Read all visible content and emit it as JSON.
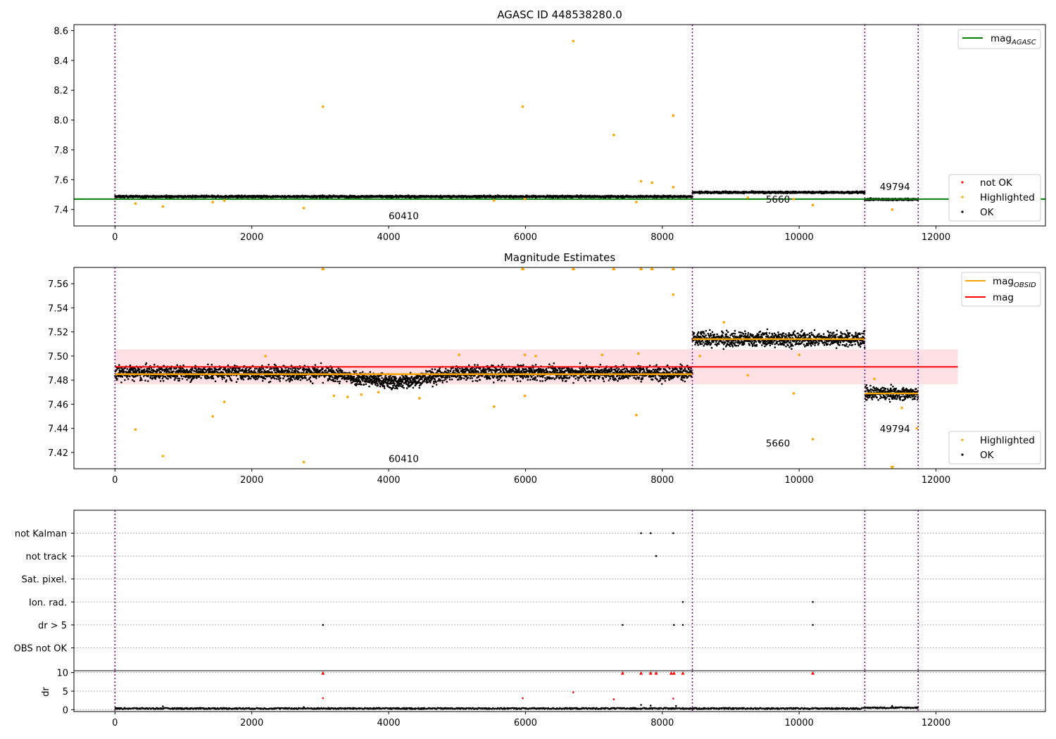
{
  "chart_data": [
    {
      "type": "scatter",
      "title": "AGASC ID 448538280.0",
      "xlabel": "",
      "ylabel": "",
      "xlim": [
        -600,
        13600
      ],
      "ylim": [
        7.29,
        8.64
      ],
      "xticks": [
        0,
        2000,
        4000,
        6000,
        8000,
        10000,
        12000
      ],
      "xtick_labels": [
        "0",
        "2000",
        "4000",
        "6000",
        "8000",
        "10000",
        "12000"
      ],
      "yticks": [
        7.4,
        7.6,
        7.8,
        8.0,
        8.2,
        8.4,
        8.6
      ],
      "ytick_labels": [
        "7.4",
        "7.6",
        "7.8",
        "8.0",
        "8.2",
        "8.4",
        "8.6"
      ],
      "grid": false,
      "obsid_boundaries": [
        0,
        8440,
        10960,
        11740
      ],
      "segments": [
        {
          "x_start": 0,
          "x_end": 8440,
          "y_start": 7.487,
          "y_end": 7.487,
          "spread": 0.006
        },
        {
          "x_start": 8440,
          "x_end": 10960,
          "y_start": 7.515,
          "y_end": 7.515,
          "spread": 0.006
        },
        {
          "x_start": 10960,
          "x_end": 11740,
          "y_start": 7.468,
          "y_end": 7.468,
          "spread": 0.006
        }
      ],
      "highlighted_points": [
        {
          "x": 300,
          "y": 7.44
        },
        {
          "x": 700,
          "y": 7.42
        },
        {
          "x": 1430,
          "y": 7.45
        },
        {
          "x": 1600,
          "y": 7.46
        },
        {
          "x": 2760,
          "y": 7.41
        },
        {
          "x": 3040,
          "y": 8.09
        },
        {
          "x": 5540,
          "y": 7.46
        },
        {
          "x": 5960,
          "y": 8.09
        },
        {
          "x": 5990,
          "y": 7.47
        },
        {
          "x": 6700,
          "y": 8.53
        },
        {
          "x": 7290,
          "y": 7.9
        },
        {
          "x": 7620,
          "y": 7.45
        },
        {
          "x": 7690,
          "y": 7.59
        },
        {
          "x": 7850,
          "y": 7.58
        },
        {
          "x": 8160,
          "y": 8.03
        },
        {
          "x": 8160,
          "y": 7.55
        },
        {
          "x": 9250,
          "y": 7.48
        },
        {
          "x": 9920,
          "y": 7.47
        },
        {
          "x": 10200,
          "y": 7.43
        },
        {
          "x": 11360,
          "y": 7.4
        }
      ],
      "reference_line": {
        "name": "mag_AGASC",
        "y": 7.47,
        "color": "#008000"
      },
      "annotations": [
        {
          "text": "60410",
          "x": 4220,
          "y": 7.335
        },
        {
          "text": "5660",
          "x": 9690,
          "y": 7.445
        },
        {
          "text": "49794",
          "x": 11400,
          "y": 7.53
        }
      ],
      "legends": [
        {
          "position": "upper-right",
          "entries": [
            {
              "label": "mag",
              "subscript": "AGASC",
              "kind": "line",
              "color": "#008000"
            }
          ]
        },
        {
          "position": "lower-right",
          "entries": [
            {
              "label": "not OK",
              "kind": "marker",
              "color": "#ff0000"
            },
            {
              "label": "Highlighted",
              "kind": "marker",
              "color": "#ffa500"
            },
            {
              "label": "OK",
              "kind": "marker",
              "color": "#000000"
            }
          ]
        }
      ]
    },
    {
      "type": "scatter",
      "title": "Magnitude Estimates",
      "xlabel": "",
      "ylabel": "",
      "xlim": [
        -600,
        13600
      ],
      "ylim": [
        7.4065,
        7.5735
      ],
      "xticks": [
        0,
        2000,
        4000,
        6000,
        8000,
        10000,
        12000
      ],
      "xtick_labels": [
        "0",
        "2000",
        "4000",
        "6000",
        "8000",
        "10000",
        "12000"
      ],
      "yticks": [
        7.42,
        7.44,
        7.46,
        7.48,
        7.5,
        7.52,
        7.54,
        7.56
      ],
      "ytick_labels": [
        "7.42",
        "7.44",
        "7.46",
        "7.48",
        "7.50",
        "7.52",
        "7.54",
        "7.56"
      ],
      "grid": false,
      "obsid_boundaries": [
        0,
        8440,
        10960,
        11740
      ],
      "segments": [
        {
          "x_start": 0,
          "x_end": 3000,
          "y_start": 7.486,
          "y_end": 7.486,
          "spread": 0.006
        },
        {
          "x_start": 3000,
          "x_end": 4100,
          "y_start": 7.486,
          "y_end": 7.478,
          "spread": 0.006
        },
        {
          "x_start": 4100,
          "x_end": 4900,
          "y_start": 7.478,
          "y_end": 7.485,
          "spread": 0.006
        },
        {
          "x_start": 4900,
          "x_end": 8440,
          "y_start": 7.486,
          "y_end": 7.486,
          "spread": 0.006
        },
        {
          "x_start": 8440,
          "x_end": 10960,
          "y_start": 7.514,
          "y_end": 7.514,
          "spread": 0.006
        },
        {
          "x_start": 10960,
          "x_end": 11740,
          "y_start": 7.469,
          "y_end": 7.469,
          "spread": 0.005
        }
      ],
      "obsid_means": [
        {
          "x_start": 0,
          "x_end": 8440,
          "y": 7.485
        },
        {
          "x_start": 8440,
          "x_end": 10960,
          "y": 7.514
        },
        {
          "x_start": 10960,
          "x_end": 11740,
          "y": 7.469
        }
      ],
      "mag_line": {
        "y": 7.491,
        "x_start": 0,
        "x_end": 12320,
        "color": "#ff0000"
      },
      "mag_band": {
        "y_low": 7.4765,
        "y_high": 7.5055,
        "x_start": 0,
        "x_end": 12320,
        "color": "#ffe0e5"
      },
      "highlighted_points": [
        {
          "x": 300,
          "y": 7.439
        },
        {
          "x": 700,
          "y": 7.417
        },
        {
          "x": 1430,
          "y": 7.45
        },
        {
          "x": 1600,
          "y": 7.462
        },
        {
          "x": 2760,
          "y": 7.412
        },
        {
          "x": 2200,
          "y": 7.5
        },
        {
          "x": 3200,
          "y": 7.467
        },
        {
          "x": 3400,
          "y": 7.466
        },
        {
          "x": 3600,
          "y": 7.468
        },
        {
          "x": 3850,
          "y": 7.47
        },
        {
          "x": 4450,
          "y": 7.465
        },
        {
          "x": 5030,
          "y": 7.501
        },
        {
          "x": 5540,
          "y": 7.458
        },
        {
          "x": 5990,
          "y": 7.467
        },
        {
          "x": 5990,
          "y": 7.501
        },
        {
          "x": 6150,
          "y": 7.5
        },
        {
          "x": 7120,
          "y": 7.501
        },
        {
          "x": 7620,
          "y": 7.451
        },
        {
          "x": 7650,
          "y": 7.502
        },
        {
          "x": 8160,
          "y": 7.551
        },
        {
          "x": 8550,
          "y": 7.5
        },
        {
          "x": 8900,
          "y": 7.528
        },
        {
          "x": 9250,
          "y": 7.484
        },
        {
          "x": 9920,
          "y": 7.469
        },
        {
          "x": 10000,
          "y": 7.501
        },
        {
          "x": 10200,
          "y": 7.431
        },
        {
          "x": 11500,
          "y": 7.457
        },
        {
          "x": 11720,
          "y": 7.44
        },
        {
          "x": 11100,
          "y": 7.481
        }
      ],
      "clipped_points": [
        {
          "x": 3040,
          "y": 7.5735
        },
        {
          "x": 5960,
          "y": 7.5735
        },
        {
          "x": 6700,
          "y": 7.5735
        },
        {
          "x": 7290,
          "y": 7.5735
        },
        {
          "x": 7690,
          "y": 7.5735
        },
        {
          "x": 7850,
          "y": 7.5735
        },
        {
          "x": 8160,
          "y": 7.5735
        },
        {
          "x": 11360,
          "y": 7.4065
        }
      ],
      "annotations": [
        {
          "text": "60410",
          "x": 4220,
          "y": 7.412
        },
        {
          "text": "5660",
          "x": 9690,
          "y": 7.425
        },
        {
          "text": "49794",
          "x": 11400,
          "y": 7.437
        }
      ],
      "legends": [
        {
          "position": "upper-right",
          "entries": [
            {
              "label": "mag",
              "subscript": "OBSID",
              "kind": "line",
              "color": "#ffa500"
            },
            {
              "label": "mag",
              "subscript": "",
              "kind": "line",
              "color": "#ff0000"
            }
          ]
        },
        {
          "position": "lower-right",
          "entries": [
            {
              "label": "Highlighted",
              "kind": "marker",
              "color": "#ffa500"
            },
            {
              "label": "OK",
              "kind": "marker",
              "color": "#000000"
            }
          ]
        }
      ]
    },
    {
      "type": "scatter",
      "title": "",
      "xlabel": "",
      "ylabel": "",
      "xlim": [
        -600,
        13600
      ],
      "categories": [
        "OBS not OK",
        "dr > 5",
        "Ion. rad.",
        "Sat. pixel.",
        "not track",
        "not Kalman"
      ],
      "grid": true,
      "obsid_boundaries": [
        0,
        8440,
        10960,
        11740
      ],
      "flags": [
        {
          "category": "not Kalman",
          "x": [
            7690,
            7830,
            8160
          ]
        },
        {
          "category": "not track",
          "x": [
            7910
          ]
        },
        {
          "category": "Ion. rad.",
          "x": [
            8300,
            10200
          ]
        },
        {
          "category": "dr > 5",
          "x": [
            3040,
            7420,
            8170,
            8300,
            10200
          ]
        }
      ]
    },
    {
      "type": "scatter",
      "title": "",
      "xlabel": "",
      "ylabel": "dr",
      "xlim": [
        -600,
        13600
      ],
      "ylim": [
        -0.5,
        10.5
      ],
      "xticks": [
        0,
        2000,
        4000,
        6000,
        8000,
        10000,
        12000
      ],
      "xtick_labels": [
        "0",
        "2000",
        "4000",
        "6000",
        "8000",
        "10000",
        "12000"
      ],
      "yticks": [
        0,
        5,
        10
      ],
      "ytick_labels": [
        "0",
        "5",
        "10"
      ],
      "grid": true,
      "obsid_boundaries": [
        0,
        8440,
        10960,
        11740
      ],
      "clip_value": 10,
      "clipped_points_x": [
        3040,
        7420,
        7690,
        7830,
        7910,
        8130,
        8170,
        8300,
        10200
      ],
      "points": [
        {
          "x": 3040,
          "y": 3.1
        },
        {
          "x": 5960,
          "y": 3.1
        },
        {
          "x": 6700,
          "y": 4.7
        },
        {
          "x": 7290,
          "y": 2.8
        },
        {
          "x": 7690,
          "y": 1.3
        },
        {
          "x": 7830,
          "y": 1.1
        },
        {
          "x": 8160,
          "y": 3.0
        },
        {
          "x": 8200,
          "y": 1.0
        },
        {
          "x": 700,
          "y": 0.9
        },
        {
          "x": 2760,
          "y": 0.7
        },
        {
          "x": 11360,
          "y": 1.0
        }
      ],
      "baseline": [
        {
          "x_start": 0,
          "x_end": 10960,
          "y": 0.15
        },
        {
          "x_start": 10960,
          "x_end": 11740,
          "y": 0.35
        }
      ]
    }
  ]
}
